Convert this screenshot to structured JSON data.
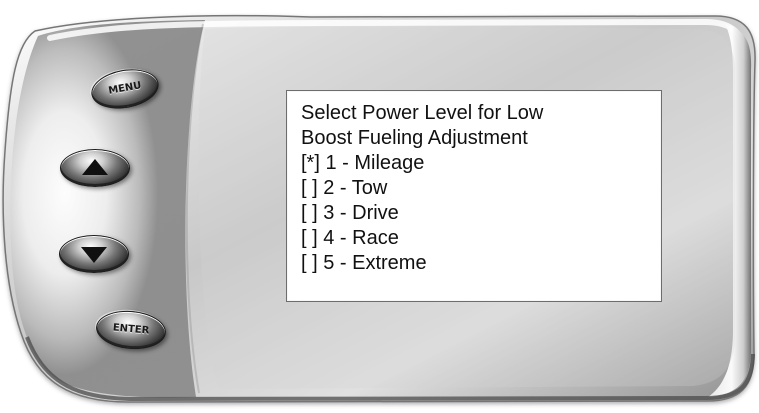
{
  "device": {
    "buttons": {
      "menu_label": "MENU",
      "up_icon": "triangle-up-icon",
      "down_icon": "triangle-down-icon",
      "enter_label": "ENTER"
    },
    "screen": {
      "lines": [
        "Select Power Level for Low",
        "Boost Fueling Adjustment",
        "[*] 1 - Mileage",
        "[ ] 2 - Tow",
        "[ ] 3 - Drive",
        "[ ] 4 - Race",
        "[ ] 5 - Extreme"
      ]
    }
  },
  "colors": {
    "screen_background": "#ffffff",
    "screen_text": "#111111",
    "bezel_light": "#f5f5f5",
    "bezel_mid": "#bdbdbd",
    "bezel_dark": "#3c3c3c",
    "button_dark": "#101010"
  }
}
